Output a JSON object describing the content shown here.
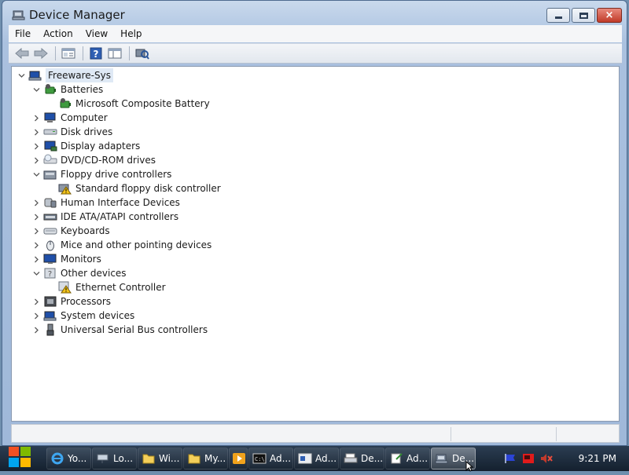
{
  "window": {
    "title": "Device Manager",
    "title_icon": "device-manager-icon",
    "caption_buttons": {
      "minimize": "minimize-icon",
      "maximize": "maximize-icon",
      "close": "×"
    }
  },
  "menu": [
    "File",
    "Action",
    "View",
    "Help"
  ],
  "toolbar": [
    "back-arrow-icon",
    "forward-arrow-icon",
    "properties-icon",
    "help-icon",
    "view-icon",
    "scan-hardware-icon"
  ],
  "tree": {
    "root": "Freeware-Sys",
    "nodes": [
      {
        "label": "Batteries",
        "expanded": true,
        "icon": "battery-icon",
        "children": [
          {
            "label": "Microsoft Composite Battery",
            "icon": "battery-icon"
          }
        ]
      },
      {
        "label": "Computer",
        "expanded": false,
        "icon": "computer-icon"
      },
      {
        "label": "Disk drives",
        "expanded": false,
        "icon": "disk-drive-icon"
      },
      {
        "label": "Display adapters",
        "expanded": false,
        "icon": "display-adapter-icon"
      },
      {
        "label": "DVD/CD-ROM drives",
        "expanded": false,
        "icon": "dvd-drive-icon"
      },
      {
        "label": "Floppy drive controllers",
        "expanded": true,
        "icon": "floppy-controller-icon",
        "children": [
          {
            "label": "Standard floppy disk controller",
            "icon": "floppy-controller-warning-icon"
          }
        ]
      },
      {
        "label": "Human Interface Devices",
        "expanded": false,
        "icon": "hid-icon"
      },
      {
        "label": "IDE ATA/ATAPI controllers",
        "expanded": false,
        "icon": "ide-controller-icon"
      },
      {
        "label": "Keyboards",
        "expanded": false,
        "icon": "keyboard-icon"
      },
      {
        "label": "Mice and other pointing devices",
        "expanded": false,
        "icon": "mouse-icon"
      },
      {
        "label": "Monitors",
        "expanded": false,
        "icon": "monitor-icon"
      },
      {
        "label": "Other devices",
        "expanded": true,
        "icon": "other-devices-icon",
        "children": [
          {
            "label": "Ethernet Controller",
            "icon": "unknown-device-warning-icon"
          }
        ]
      },
      {
        "label": "Processors",
        "expanded": false,
        "icon": "processor-icon"
      },
      {
        "label": "System devices",
        "expanded": false,
        "icon": "system-devices-icon"
      },
      {
        "label": "Universal Serial Bus controllers",
        "expanded": false,
        "icon": "usb-icon"
      }
    ]
  },
  "taskbar": {
    "start_icon": "windows-logo-icon",
    "buttons": [
      {
        "label": "Yo...",
        "icon": "internet-explorer-icon"
      },
      {
        "label": "Lo...",
        "icon": "network-drive-icon"
      },
      {
        "label": "Wi...",
        "icon": "folder-icon"
      },
      {
        "label": "My...",
        "icon": "folder-icon"
      },
      {
        "label": "",
        "icon": "media-player-icon"
      },
      {
        "label": "Ad...",
        "icon": "command-prompt-icon"
      },
      {
        "label": "Ad...",
        "icon": "admin-window-icon"
      },
      {
        "label": "De...",
        "icon": "printer-icon"
      },
      {
        "label": "Ad...",
        "icon": "notepad-icon"
      },
      {
        "label": "De...",
        "icon": "device-manager-icon",
        "active": true
      }
    ],
    "tray_icons": [
      "flag-icon",
      "network-warning-icon",
      "volume-muted-icon"
    ],
    "clock": "9:21 PM"
  }
}
